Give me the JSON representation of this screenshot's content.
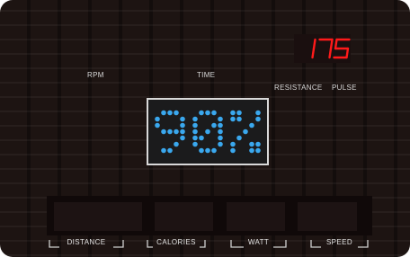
{
  "labels": {
    "rpm": "RPM",
    "time": "TIME",
    "resistance": "RESISTANCE",
    "pulse": "PULSE"
  },
  "displays": {
    "pulse_value": "175",
    "main_value": "90%"
  },
  "buttons": {
    "distance": "DISTANCE",
    "calories": "CALORIES",
    "watt": "WATT",
    "speed": "SPEED"
  },
  "colors": {
    "panel": "#1d1412",
    "led_red": "#ff1a1a",
    "led_blue": "#3aa8ee",
    "label_gray": "#d8d8d8"
  }
}
